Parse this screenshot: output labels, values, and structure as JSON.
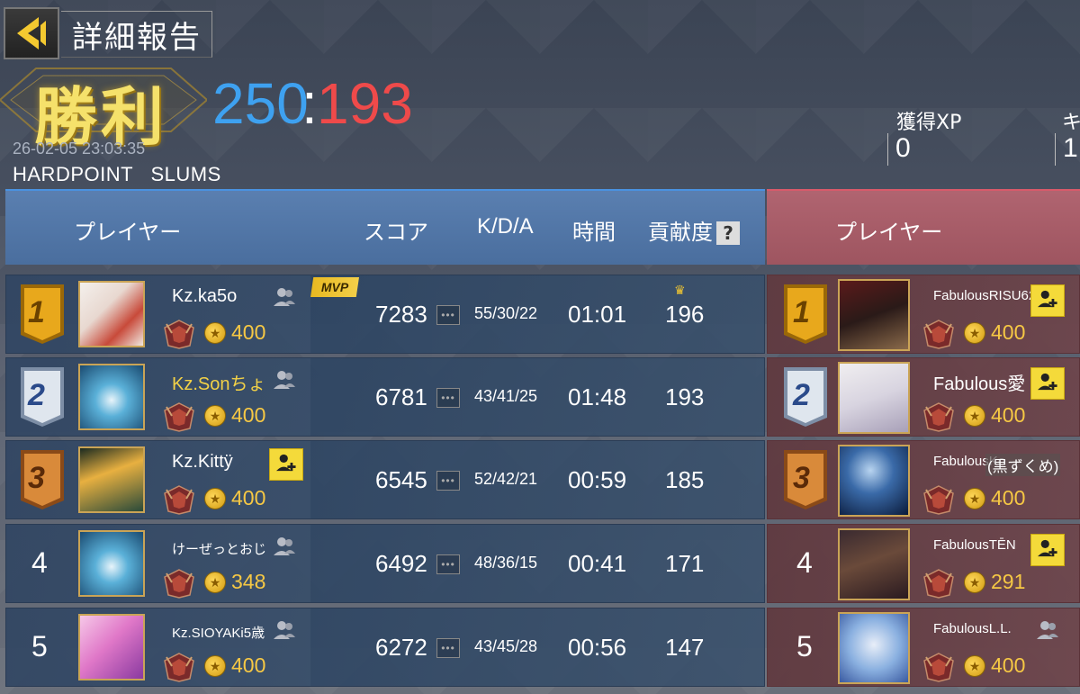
{
  "header": {
    "title": "詳細報告",
    "result": "勝利",
    "score_blue": "250",
    "score_sep": ":",
    "score_red": "193",
    "datetime": "26-02-05 23:03:35",
    "mode": "HARDPOINT   SLUMS",
    "xp_label": "獲得XP",
    "xp_value": "0",
    "second_label": "キ",
    "second_value": "1."
  },
  "columns": {
    "player": "プレイヤー",
    "score": "スコア",
    "kda": "K/D/A",
    "time": "時間",
    "contribution": "貢献度",
    "help": "?",
    "enemy_player": "プレイヤー"
  },
  "mvp_label": "MVP",
  "colors": {
    "blue_accent": "#3ea1f0",
    "red_accent": "#ef4a4a",
    "victory_gold": "#f5e16b",
    "coin_gold": "#f6c844"
  },
  "team_blue": [
    {
      "rank": "1",
      "name": "Kz.ka5o",
      "coins": "400",
      "score": "7283",
      "kda": "55/30/22",
      "time": "01:01",
      "contribution": "196"
    },
    {
      "rank": "2",
      "name": "Kz.Sonちょ",
      "coins": "400",
      "score": "6781",
      "kda": "43/41/25",
      "time": "01:48",
      "contribution": "193"
    },
    {
      "rank": "3",
      "name": "Kz.Kittÿ",
      "coins": "400",
      "score": "6545",
      "kda": "52/42/21",
      "time": "00:59",
      "contribution": "185"
    },
    {
      "rank": "4",
      "name": "けーぜっとおじ",
      "coins": "348",
      "score": "6492",
      "kda": "48/36/15",
      "time": "00:41",
      "contribution": "171"
    },
    {
      "rank": "5",
      "name": "Kz.SIOYAKi5歳",
      "coins": "400",
      "score": "6272",
      "kda": "43/45/28",
      "time": "00:56",
      "contribution": "147"
    }
  ],
  "team_red": [
    {
      "rank": "1",
      "name": "FabulousRISU62",
      "coins": "400"
    },
    {
      "rank": "2",
      "name": "Fabulous愛",
      "coins": "400"
    },
    {
      "rank": "3",
      "name": "FabulousKo",
      "overlay": "(黒ずくめ)",
      "coins": "400"
    },
    {
      "rank": "4",
      "name": "FabulousTĒN",
      "coins": "291"
    },
    {
      "rank": "5",
      "name": "FabulousL.L.",
      "coins": "400"
    }
  ]
}
